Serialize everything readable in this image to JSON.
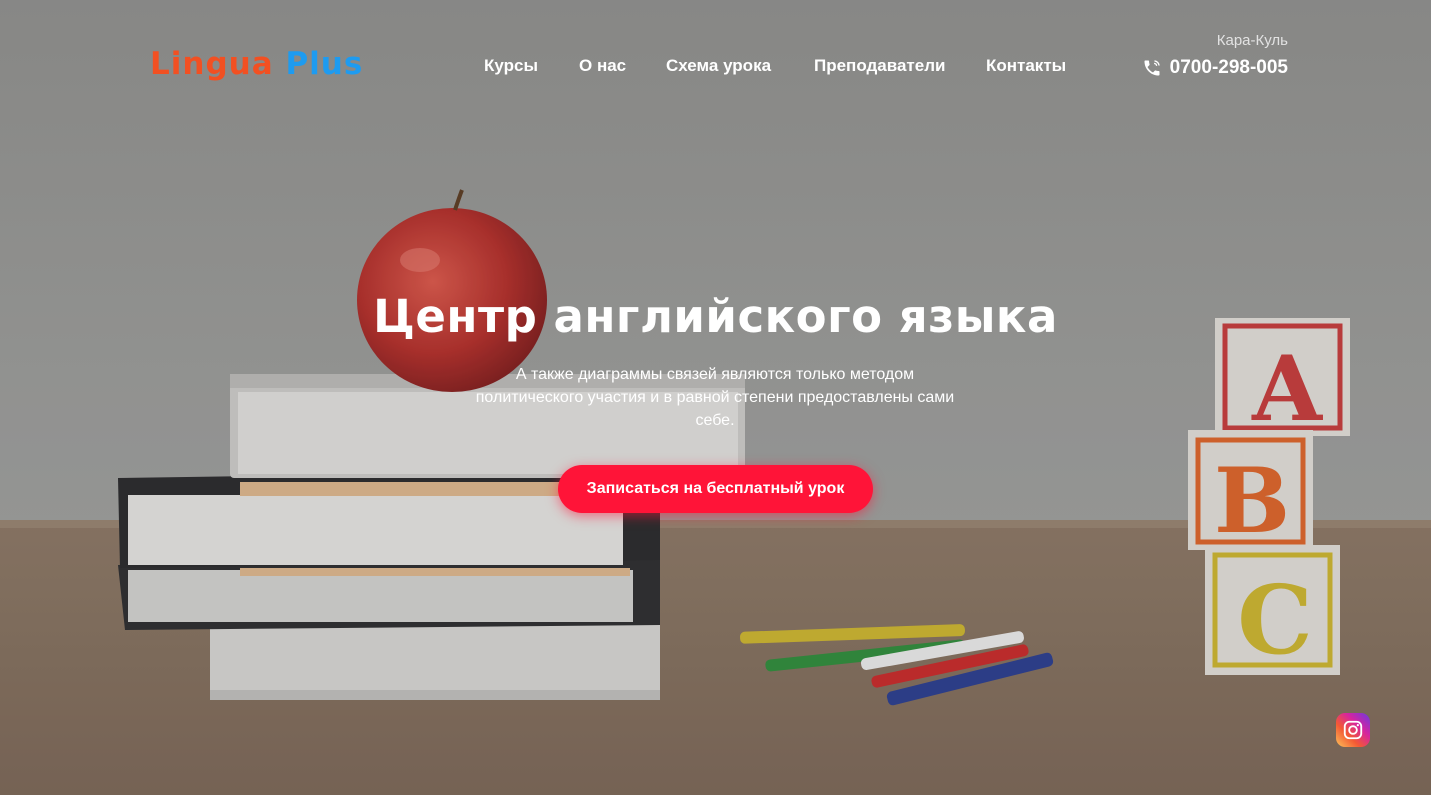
{
  "brand": {
    "logo_part1": "Lingua",
    "logo_part2": "Plus",
    "color_part1": "#f25022",
    "color_part2": "#1e9bf0"
  },
  "nav": {
    "items": [
      {
        "label": "Курсы"
      },
      {
        "label": "О нас"
      },
      {
        "label": "Схема урока"
      },
      {
        "label": "Преподаватели"
      },
      {
        "label": "Контакты"
      }
    ]
  },
  "contact": {
    "city": "Кара-Куль",
    "phone": "0700-298-005",
    "phone_icon": "phone-icon"
  },
  "hero": {
    "title": "Центр английского языка",
    "subtitle": "А также диаграммы связей являются только методом политического участия и в равной степени предоставлены сами себе.",
    "cta_label": "Записаться на бесплатный урок",
    "cta_color": "#ff1438"
  },
  "social": {
    "instagram_icon": "instagram-icon"
  }
}
